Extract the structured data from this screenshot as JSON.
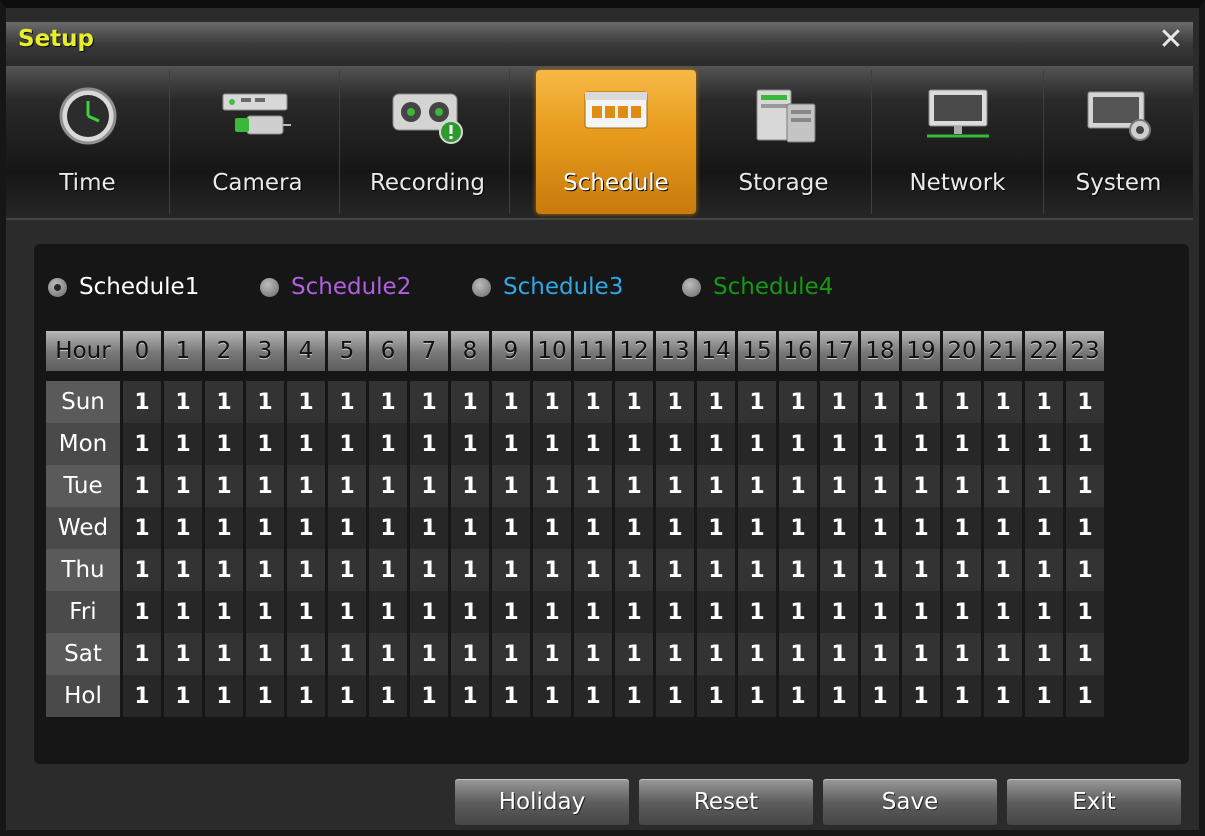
{
  "window": {
    "title": "Setup",
    "close_glyph": "✕"
  },
  "tabs": [
    {
      "label": "Time",
      "icon": "clock-icon",
      "active": false
    },
    {
      "label": "Camera",
      "icon": "camera-icon",
      "active": false
    },
    {
      "label": "Recording",
      "icon": "recording-icon",
      "active": false
    },
    {
      "label": "Schedule",
      "icon": "schedule-icon",
      "active": true
    },
    {
      "label": "Storage",
      "icon": "storage-icon",
      "active": false
    },
    {
      "label": "Network",
      "icon": "network-icon",
      "active": false
    },
    {
      "label": "System",
      "icon": "system-icon",
      "active": false
    }
  ],
  "schedules": [
    {
      "label": "Schedule1",
      "color": "#ffffff",
      "selected": true
    },
    {
      "label": "Schedule2",
      "color": "#b25fe0",
      "selected": false
    },
    {
      "label": "Schedule3",
      "color": "#2fa8e6",
      "selected": false
    },
    {
      "label": "Schedule4",
      "color": "#129a12",
      "selected": false
    }
  ],
  "grid": {
    "corner_label": "Hour",
    "hours": [
      "0",
      "1",
      "2",
      "3",
      "4",
      "5",
      "6",
      "7",
      "8",
      "9",
      "10",
      "11",
      "12",
      "13",
      "14",
      "15",
      "16",
      "17",
      "18",
      "19",
      "20",
      "21",
      "22",
      "23"
    ],
    "rows": [
      {
        "day": "Sun",
        "values": [
          "1",
          "1",
          "1",
          "1",
          "1",
          "1",
          "1",
          "1",
          "1",
          "1",
          "1",
          "1",
          "1",
          "1",
          "1",
          "1",
          "1",
          "1",
          "1",
          "1",
          "1",
          "1",
          "1",
          "1"
        ]
      },
      {
        "day": "Mon",
        "values": [
          "1",
          "1",
          "1",
          "1",
          "1",
          "1",
          "1",
          "1",
          "1",
          "1",
          "1",
          "1",
          "1",
          "1",
          "1",
          "1",
          "1",
          "1",
          "1",
          "1",
          "1",
          "1",
          "1",
          "1"
        ]
      },
      {
        "day": "Tue",
        "values": [
          "1",
          "1",
          "1",
          "1",
          "1",
          "1",
          "1",
          "1",
          "1",
          "1",
          "1",
          "1",
          "1",
          "1",
          "1",
          "1",
          "1",
          "1",
          "1",
          "1",
          "1",
          "1",
          "1",
          "1"
        ]
      },
      {
        "day": "Wed",
        "values": [
          "1",
          "1",
          "1",
          "1",
          "1",
          "1",
          "1",
          "1",
          "1",
          "1",
          "1",
          "1",
          "1",
          "1",
          "1",
          "1",
          "1",
          "1",
          "1",
          "1",
          "1",
          "1",
          "1",
          "1"
        ]
      },
      {
        "day": "Thu",
        "values": [
          "1",
          "1",
          "1",
          "1",
          "1",
          "1",
          "1",
          "1",
          "1",
          "1",
          "1",
          "1",
          "1",
          "1",
          "1",
          "1",
          "1",
          "1",
          "1",
          "1",
          "1",
          "1",
          "1",
          "1"
        ]
      },
      {
        "day": "Fri",
        "values": [
          "1",
          "1",
          "1",
          "1",
          "1",
          "1",
          "1",
          "1",
          "1",
          "1",
          "1",
          "1",
          "1",
          "1",
          "1",
          "1",
          "1",
          "1",
          "1",
          "1",
          "1",
          "1",
          "1",
          "1"
        ]
      },
      {
        "day": "Sat",
        "values": [
          "1",
          "1",
          "1",
          "1",
          "1",
          "1",
          "1",
          "1",
          "1",
          "1",
          "1",
          "1",
          "1",
          "1",
          "1",
          "1",
          "1",
          "1",
          "1",
          "1",
          "1",
          "1",
          "1",
          "1"
        ]
      },
      {
        "day": "Hol",
        "values": [
          "1",
          "1",
          "1",
          "1",
          "1",
          "1",
          "1",
          "1",
          "1",
          "1",
          "1",
          "1",
          "1",
          "1",
          "1",
          "1",
          "1",
          "1",
          "1",
          "1",
          "1",
          "1",
          "1",
          "1"
        ]
      }
    ]
  },
  "buttons": {
    "holiday": "Holiday",
    "reset": "Reset",
    "save": "Save",
    "exit": "Exit"
  }
}
